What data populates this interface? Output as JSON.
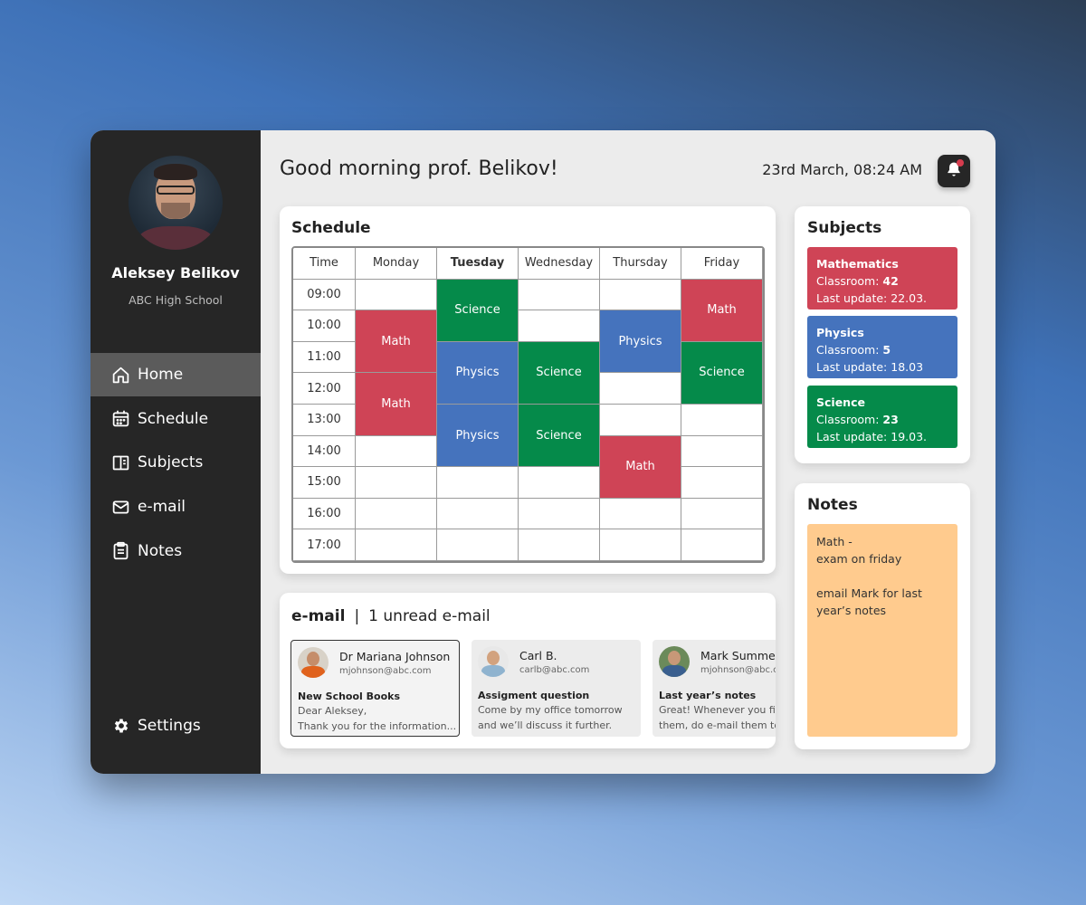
{
  "profile": {
    "name": "Aleksey Belikov",
    "school": "ABC High School"
  },
  "nav": {
    "items": [
      {
        "label": "Home",
        "icon": "home-icon",
        "active": true
      },
      {
        "label": "Schedule",
        "icon": "calendar-icon",
        "active": false
      },
      {
        "label": "Subjects",
        "icon": "book-icon",
        "active": false
      },
      {
        "label": "e-mail",
        "icon": "mail-icon",
        "active": false
      },
      {
        "label": "Notes",
        "icon": "notes-icon",
        "active": false
      }
    ],
    "settings": {
      "label": "Settings",
      "icon": "gear-icon"
    }
  },
  "header": {
    "greeting": "Good morning prof. Belikov!",
    "datetime": "23rd March, 08:24 AM",
    "notification_icon": "bell-icon",
    "notification_dot_color": "#d63c4e"
  },
  "schedule": {
    "title": "Schedule",
    "time_header": "Time",
    "days": [
      "Monday",
      "Tuesday",
      "Wednesday",
      "Thursday",
      "Friday"
    ],
    "current_day": "Tuesday",
    "times": [
      "09:00",
      "10:00",
      "11:00",
      "12:00",
      "13:00",
      "14:00",
      "15:00",
      "16:00",
      "17:00"
    ],
    "classes": [
      {
        "day": "Monday",
        "subject": "Math",
        "start": "10:00",
        "end": "12:00"
      },
      {
        "day": "Monday",
        "subject": "Math",
        "start": "12:00",
        "end": "14:00"
      },
      {
        "day": "Tuesday",
        "subject": "Science",
        "start": "09:00",
        "end": "11:00"
      },
      {
        "day": "Tuesday",
        "subject": "Physics",
        "start": "11:00",
        "end": "13:00"
      },
      {
        "day": "Tuesday",
        "subject": "Physics",
        "start": "13:00",
        "end": "15:00"
      },
      {
        "day": "Wednesday",
        "subject": "Science",
        "start": "11:00",
        "end": "13:00"
      },
      {
        "day": "Wednesday",
        "subject": "Science",
        "start": "13:00",
        "end": "15:00"
      },
      {
        "day": "Thursday",
        "subject": "Physics",
        "start": "10:00",
        "end": "12:00"
      },
      {
        "day": "Thursday",
        "subject": "Math",
        "start": "14:00",
        "end": "16:00"
      },
      {
        "day": "Friday",
        "subject": "Math",
        "start": "09:00",
        "end": "11:00"
      },
      {
        "day": "Friday",
        "subject": "Science",
        "start": "11:00",
        "end": "13:00"
      }
    ]
  },
  "colors": {
    "Math": "#cf4456",
    "Physics": "#4573bd",
    "Science": "#058a4a"
  },
  "email": {
    "title": "e-mail",
    "separator": "|",
    "unread": "1 unread e-mail",
    "messages": [
      {
        "from": "Dr Mariana Johnson",
        "address": "mjohnson@abc.com",
        "subject": "New School Books",
        "line1": "Dear Aleksey,",
        "line2": "Thank you for the information...",
        "selected": true
      },
      {
        "from": "Carl B.",
        "address": "carlb@abc.com",
        "subject": "Assigment question",
        "line1": "Come by my office tomorrow",
        "line2": "and we’ll discuss it further.",
        "selected": false
      },
      {
        "from": "Mark Summer",
        "address": "mjohnson@abc.com",
        "subject": "Last year’s notes",
        "line1": "Great! Whenever you find",
        "line2": "them, do e-mail them to me",
        "selected": false
      }
    ]
  },
  "subjects": {
    "title": "Subjects",
    "classroom_label": "Classroom:",
    "items": [
      {
        "name": "Mathematics",
        "classroom": "42",
        "last_update": "Last update: 22.03."
      },
      {
        "name": "Physics",
        "classroom": "5",
        "last_update": "Last update: 18.03"
      },
      {
        "name": "Science",
        "classroom": "23",
        "last_update": "Last update: 19.03."
      }
    ]
  },
  "notes": {
    "title": "Notes",
    "line1": "Math -",
    "line2": "exam on friday",
    "line3": "email Mark for last",
    "line4": "year’s notes"
  }
}
